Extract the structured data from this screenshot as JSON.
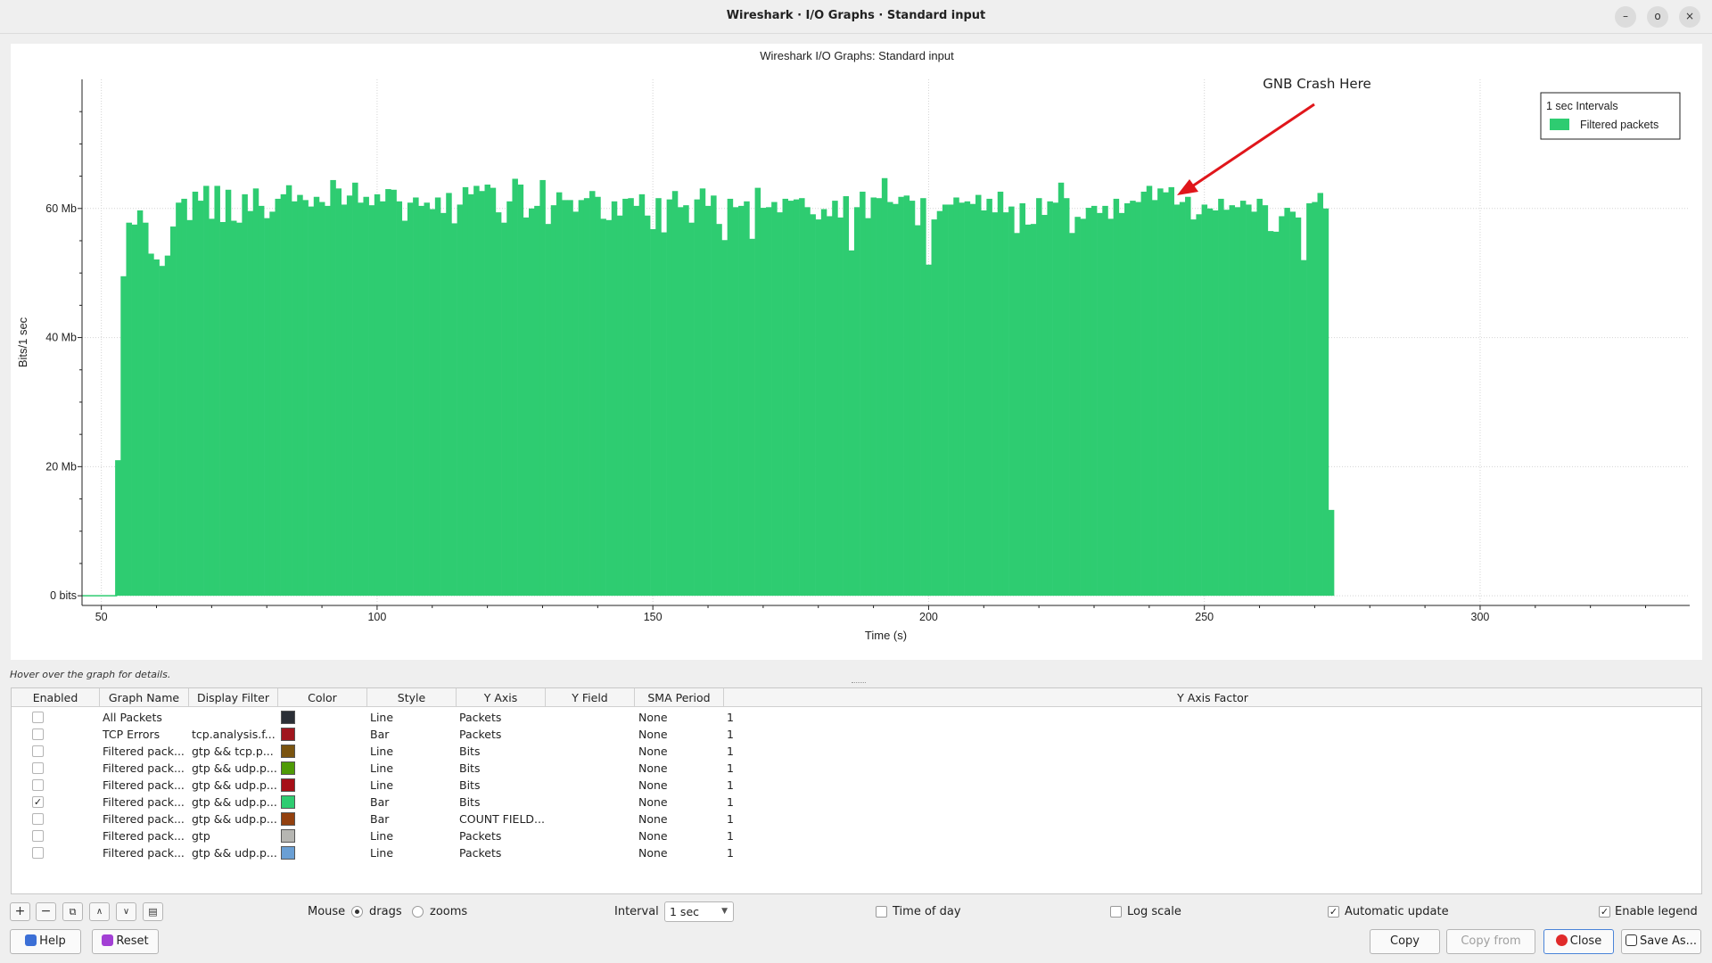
{
  "window": {
    "title": "Wireshark · I/O Graphs · Standard input"
  },
  "window_buttons": {
    "minimize": "–",
    "restore": "o",
    "close": "×"
  },
  "graph": {
    "title": "Wireshark I/O Graphs: Standard input",
    "annotation": "GNB Crash Here",
    "legend_header": "1 sec Intervals",
    "legend_series": "Filtered packets",
    "bar_color": "#2ecc71",
    "arrow_color": "#e0161b"
  },
  "chart_data": {
    "type": "bar",
    "title": "Wireshark I/O Graphs: Standard input",
    "xlabel": "Time (s)",
    "ylabel": "Bits/1 sec",
    "xlim": [
      46.5,
      338
    ],
    "ylim": [
      -1.5,
      80
    ],
    "x_ticks": [
      50,
      100,
      150,
      200,
      250,
      300
    ],
    "y_ticks": [
      {
        "value": 0,
        "label": "0 bits"
      },
      {
        "value": 20,
        "label": "20 Mb"
      },
      {
        "value": 40,
        "label": "40 Mb"
      },
      {
        "value": 60,
        "label": "60 Mb"
      }
    ],
    "grid": true,
    "legend_position": "top-right",
    "bar_start_time": 53,
    "series": [
      {
        "name": "Filtered packets",
        "values": [
          21,
          49.5,
          57.8,
          57.5,
          59.7,
          57.8,
          53,
          52.1,
          51.1,
          52.7,
          57.2,
          60.9,
          61.5,
          58.2,
          62.6,
          61.2,
          63.5,
          58.4,
          63.5,
          57.9,
          62.9,
          58.1,
          57.8,
          62.2,
          59.6,
          63.1,
          60.4,
          58.5,
          59.5,
          61.5,
          62.2,
          63.6,
          61.1,
          62.1,
          61.3,
          60.3,
          61.8,
          61.0,
          60.4,
          64.4,
          63.1,
          60.6,
          62.0,
          64.0,
          60.9,
          61.8,
          60.5,
          62.2,
          61.1,
          63.0,
          62.9,
          61.1,
          58.1,
          60.9,
          61.7,
          60.4,
          60.9,
          59.9,
          61.7,
          59.3,
          62.4,
          57.7,
          60.6,
          63.3,
          62.2,
          63.5,
          62.7,
          63.7,
          63.2,
          59.4,
          57.8,
          61.1,
          64.6,
          63.7,
          58.6,
          60.0,
          60.4,
          64.4,
          57.6,
          60.5,
          62.5,
          61.3,
          61.3,
          59.5,
          61.3,
          61.6,
          62.7,
          61.8,
          58.4,
          58.2,
          61.1,
          58.9,
          61.5,
          61.6,
          60.4,
          62.2,
          58.9,
          56.8,
          61.6,
          56.3,
          61.4,
          62.7,
          60.2,
          60.5,
          57.8,
          61.4,
          63.1,
          60.4,
          62.0,
          57.6,
          55.1,
          61.5,
          60.2,
          60.4,
          61.1,
          55.3,
          63.2,
          60.1,
          60.2,
          61.0,
          59.4,
          61.5,
          61.2,
          61.4,
          61.6,
          60.2,
          59.1,
          58.3,
          59.9,
          58.8,
          61.2,
          58.6,
          61.9,
          53.5,
          60.2,
          62.6,
          58.5,
          61.7,
          61.6,
          64.7,
          61.0,
          60.7,
          61.8,
          62.0,
          61.2,
          57.4,
          61.6,
          51.3,
          58.3,
          59.6,
          60.6,
          60.6,
          61.7,
          60.9,
          61.1,
          60.7,
          62.1,
          59.7,
          61.5,
          59.4,
          62.6,
          59.4,
          60.3,
          56.2,
          60.8,
          57.5,
          57.6,
          61.6,
          59.0,
          61.1,
          60.9,
          64.0,
          61.6,
          56.2,
          58.7,
          58.4,
          60.1,
          60.4,
          59.3,
          60.4,
          58.4,
          61.5,
          59.3,
          60.8,
          61.2,
          61.0,
          62.6,
          63.5,
          61.3,
          63.1,
          62.5,
          63.3,
          60.6,
          61.0,
          61.8,
          58.3,
          59.1,
          60.6,
          60.0,
          59.7,
          61.5,
          59.8,
          60.5,
          60.2,
          61.2,
          60.6,
          59.5,
          61.5,
          60.5,
          56.5,
          56.4,
          58.8,
          60.1,
          59.5,
          58.6,
          52.0,
          60.8,
          61.0,
          62.4,
          60.0,
          13.3
        ]
      }
    ]
  },
  "hover_hint": "Hover over the graph for details.",
  "table": {
    "headers": [
      "Enabled",
      "Graph Name",
      "Display Filter",
      "Color",
      "Style",
      "Y Axis",
      "Y Field",
      "SMA Period",
      "Y Axis Factor"
    ],
    "rows": [
      {
        "enabled": false,
        "name": "All Packets",
        "filter": "",
        "color": "#2b2f36",
        "style": "Line",
        "yaxis": "Packets",
        "yfield": "",
        "sma": "None",
        "factor": "1"
      },
      {
        "enabled": false,
        "name": "TCP Errors",
        "filter": "tcp.analysis.f...",
        "color": "#a0161e",
        "style": "Bar",
        "yaxis": "Packets",
        "yfield": "",
        "sma": "None",
        "factor": "1"
      },
      {
        "enabled": false,
        "name": "Filtered pack...",
        "filter": "gtp && tcp.p...",
        "color": "#7a5410",
        "style": "Line",
        "yaxis": "Bits",
        "yfield": "",
        "sma": "None",
        "factor": "1"
      },
      {
        "enabled": false,
        "name": "Filtered pack...",
        "filter": "gtp && udp.p...",
        "color": "#4e9a06",
        "style": "Line",
        "yaxis": "Bits",
        "yfield": "",
        "sma": "None",
        "factor": "1"
      },
      {
        "enabled": false,
        "name": "Filtered pack...",
        "filter": "gtp && udp.p...",
        "color": "#a60f17",
        "style": "Line",
        "yaxis": "Bits",
        "yfield": "",
        "sma": "None",
        "factor": "1"
      },
      {
        "enabled": true,
        "name": "Filtered pack...",
        "filter": "gtp && udp.p...",
        "color": "#2ecc71",
        "style": "Bar",
        "yaxis": "Bits",
        "yfield": "",
        "sma": "None",
        "factor": "1"
      },
      {
        "enabled": false,
        "name": "Filtered pack...",
        "filter": "gtp && udp.p...",
        "color": "#93400f",
        "style": "Bar",
        "yaxis": "COUNT FIELD...",
        "yfield": "",
        "sma": "None",
        "factor": "1"
      },
      {
        "enabled": false,
        "name": "Filtered pack...",
        "filter": "gtp",
        "color": "#b6b6b2",
        "style": "Line",
        "yaxis": "Packets",
        "yfield": "",
        "sma": "None",
        "factor": "1"
      },
      {
        "enabled": false,
        "name": "Filtered pack...",
        "filter": "gtp && udp.p...",
        "color": "#6a9fd4",
        "style": "Line",
        "yaxis": "Packets",
        "yfield": "",
        "sma": "None",
        "factor": "1"
      }
    ]
  },
  "controls": {
    "mouse_label": "Mouse",
    "drags_label": "drags",
    "zooms_label": "zooms",
    "mouse_mode": "drags",
    "interval_label": "Interval",
    "interval_value": "1 sec",
    "time_of_day_label": "Time of day",
    "time_of_day": false,
    "log_scale_label": "Log scale",
    "log_scale": false,
    "auto_update_label": "Automatic update",
    "auto_update": true,
    "legend_label": "Enable legend",
    "legend": true
  },
  "toolbar_icons": [
    "add-icon",
    "remove-icon",
    "copy-graph-icon",
    "move-up-icon",
    "move-down-icon",
    "clear-icon"
  ],
  "buttons": {
    "help": "Help",
    "reset": "Reset",
    "copy": "Copy",
    "copy_from": "Copy from",
    "close": "Close",
    "save_as": "Save As..."
  }
}
